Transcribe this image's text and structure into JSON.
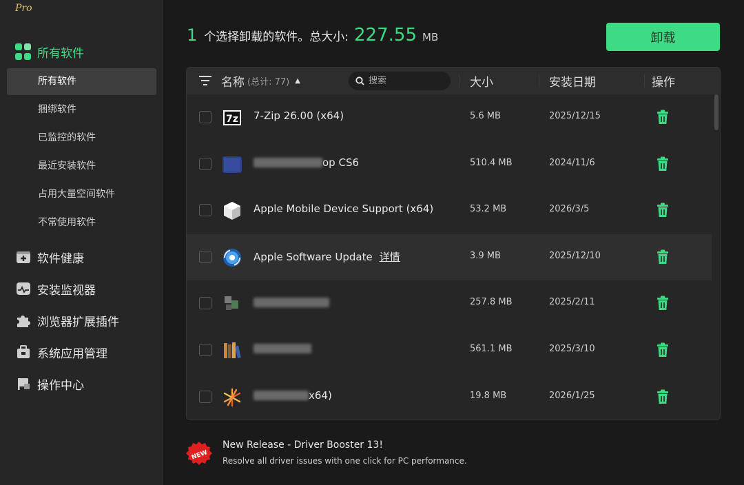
{
  "app": {
    "brand": "Pro"
  },
  "sidebar": {
    "top_item": {
      "label": "所有软件",
      "icon": "grid-icon",
      "color": "#3ddc84"
    },
    "sub_items": [
      {
        "label": "所有软件",
        "active": true
      },
      {
        "label": "捆绑软件"
      },
      {
        "label": "已监控的软件"
      },
      {
        "label": "最近安装软件"
      },
      {
        "label": "占用大量空间软件"
      },
      {
        "label": "不常使用软件"
      }
    ],
    "main_items": [
      {
        "label": "软件健康",
        "icon": "health-icon"
      },
      {
        "label": "安装监视器",
        "icon": "monitor-icon"
      },
      {
        "label": "浏览器扩展插件",
        "icon": "puzzle-icon"
      },
      {
        "label": "系统应用管理",
        "icon": "briefcase-icon"
      },
      {
        "label": "操作中心",
        "icon": "flag-icon"
      }
    ]
  },
  "summary": {
    "count": "1",
    "text": "个选择卸载的软件。总大小:",
    "size": "227.55",
    "unit": "MB"
  },
  "uninstall_button": {
    "label": "卸载",
    "color": "#3ddc84"
  },
  "table": {
    "headers": {
      "name": "名称",
      "count_note": "(总计: 77)",
      "size": "大小",
      "date": "安装日期",
      "action": "操作"
    },
    "search_placeholder": "搜索",
    "rows": [
      {
        "name": "7-Zip 26.00 (x64)",
        "size": "5.6 MB",
        "date": "2025/12/15",
        "icon": "7zip-icon"
      },
      {
        "name": "op CS6",
        "size": "510.4 MB",
        "date": "2024/11/6",
        "icon": "photoshop-icon",
        "blurred": true
      },
      {
        "name": "Apple Mobile Device Support (x64)",
        "size": "53.2 MB",
        "date": "2026/3/5",
        "icon": "apple-device-icon"
      },
      {
        "name": "Apple Software Update",
        "size": "3.9 MB",
        "date": "2025/12/10",
        "icon": "apple-update-icon",
        "detail": "详情",
        "hover": true
      },
      {
        "name": "",
        "size": "257.8 MB",
        "date": "2025/2/11",
        "icon": "app-icon",
        "blurred": true
      },
      {
        "name": "",
        "size": "561.1 MB",
        "date": "2025/3/10",
        "icon": "books-icon",
        "blurred": true
      },
      {
        "name": "x64)",
        "size": "19.8 MB",
        "date": "2026/1/25",
        "icon": "sunburst-icon",
        "blurred": true
      }
    ]
  },
  "promo": {
    "badge": "NEW",
    "title": "New Release - Driver Booster 13!",
    "subtitle": "Resolve all driver issues with one click for PC performance."
  }
}
